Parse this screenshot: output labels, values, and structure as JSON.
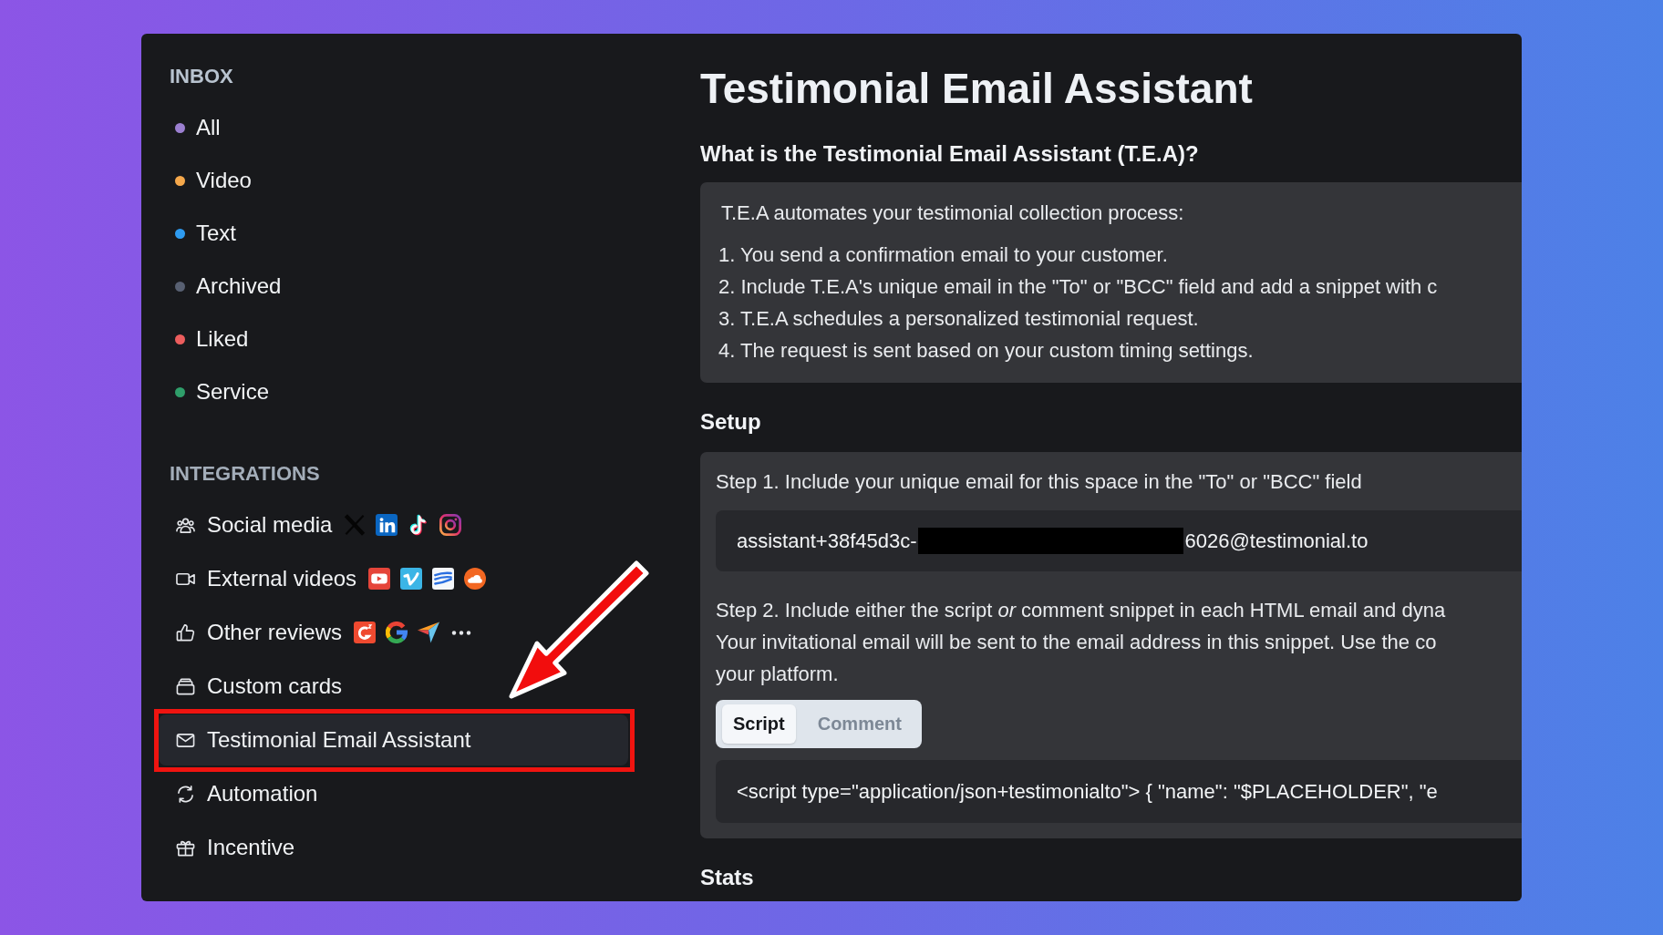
{
  "sidebar": {
    "inbox": {
      "title": "INBOX",
      "items": [
        {
          "label": "All",
          "color": "#9b7fd0",
          "selected": false
        },
        {
          "label": "Video",
          "color": "#f5a84b",
          "selected": false
        },
        {
          "label": "Text",
          "color": "#2e9bf0",
          "selected": false
        },
        {
          "label": "Archived",
          "color": "#586072",
          "selected": false
        },
        {
          "label": "Liked",
          "color": "#ec5d5d",
          "selected": false
        },
        {
          "label": "Service",
          "color": "#2f9e6a",
          "selected": false
        }
      ]
    },
    "integrations": {
      "title": "INTEGRATIONS",
      "items": [
        {
          "label": "Social media",
          "selected": false,
          "callout": false
        },
        {
          "label": "External videos",
          "selected": false,
          "callout": false
        },
        {
          "label": "Other reviews",
          "selected": false,
          "callout": false
        },
        {
          "label": "Custom cards",
          "selected": false,
          "callout": false
        },
        {
          "label": "Testimonial Email Assistant",
          "selected": true,
          "callout": true
        },
        {
          "label": "Automation",
          "selected": false,
          "callout": false
        },
        {
          "label": "Incentive",
          "selected": false,
          "callout": false
        }
      ]
    }
  },
  "main": {
    "title": "Testimonial Email Assistant",
    "intro": {
      "heading": "What is the Testimonial Email Assistant (T.E.A)?",
      "lead": "T.E.A automates your testimonial collection process:",
      "steps": [
        "1. You send a confirmation email to your customer.",
        "2. Include T.E.A's unique email in the \"To\" or \"BCC\" field and add a snippet with c",
        "3. T.E.A schedules a personalized testimonial request.",
        "4. The request is sent based on your custom timing settings."
      ]
    },
    "setup": {
      "heading": "Setup",
      "step1": "Step 1. Include your unique email for this space in the \"To\" or \"BCC\" field",
      "email": {
        "value_start": "assistant+38f45d3c-",
        "redacted": true,
        "value_end": "6026@testimonial.to"
      },
      "step2_lines": [
        "Step 2. Include either the script *or* comment snippet in each HTML email and dyna",
        "Your invitational email will be sent to the email address in this snippet. Use the co",
        "your platform."
      ],
      "tabs": [
        {
          "label": "Script",
          "selected": true
        },
        {
          "label": "Comment",
          "selected": false
        }
      ],
      "code": "<script type=\"application/json+testimonialto\"> { \"name\": \"$PLACEHOLDER\", \"e"
    },
    "stats": {
      "heading": "Stats"
    }
  }
}
